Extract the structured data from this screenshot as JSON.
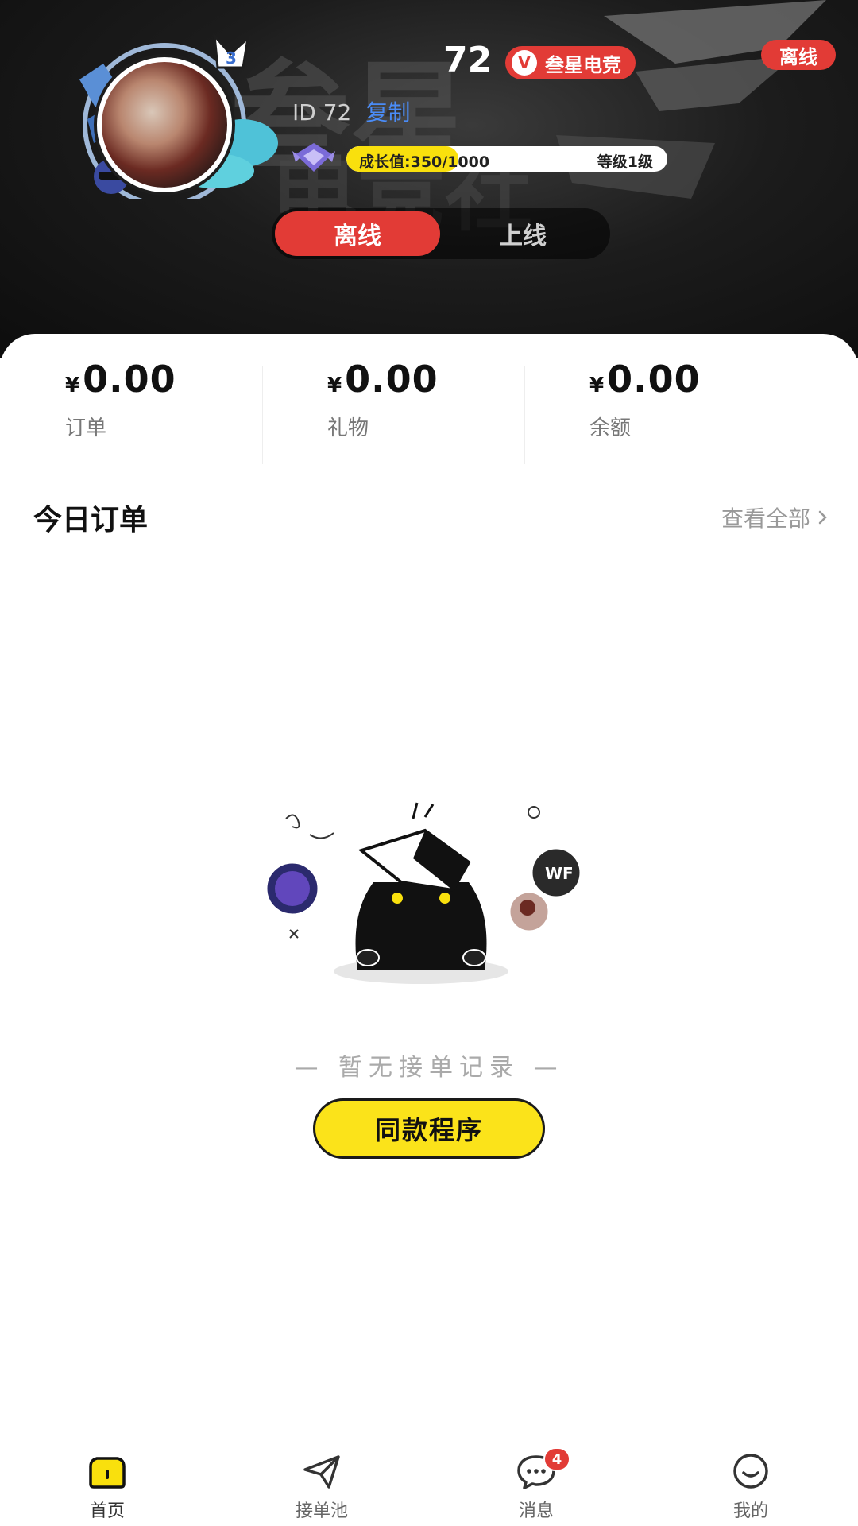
{
  "profile": {
    "number": "72",
    "vip_icon": "V",
    "vip_name": "叁星电竞",
    "status_chip": "离线",
    "id_text": "ID 72",
    "copy_label": "复制",
    "growth_text": "成长值:350/1000",
    "growth_progress": 0.35,
    "level_text": "等级1级",
    "avatar_badge": "3"
  },
  "toggle": {
    "offline": "离线",
    "online": "上线",
    "selected": "offline"
  },
  "stats": [
    {
      "currency": "¥",
      "value": "0.00",
      "label": "订单"
    },
    {
      "currency": "¥",
      "value": "0.00",
      "label": "礼物"
    },
    {
      "currency": "¥",
      "value": "0.00",
      "label": "余额"
    }
  ],
  "today_orders": {
    "title": "今日订单",
    "view_all": "查看全部",
    "empty_text": "— 暂无接单记录 —",
    "button": "同款程序"
  },
  "tabbar": {
    "items": [
      {
        "label": "首页",
        "icon": "home-icon",
        "active": true
      },
      {
        "label": "接单池",
        "icon": "paper-plane-icon",
        "active": false
      },
      {
        "label": "消息",
        "icon": "chat-bubble-icon",
        "active": false,
        "badge": "4"
      },
      {
        "label": "我的",
        "icon": "smile-face-icon",
        "active": false
      }
    ]
  },
  "colors": {
    "accent_red": "#e23b36",
    "accent_yellow": "#fbe31a",
    "link_blue": "#4a8cf7"
  }
}
